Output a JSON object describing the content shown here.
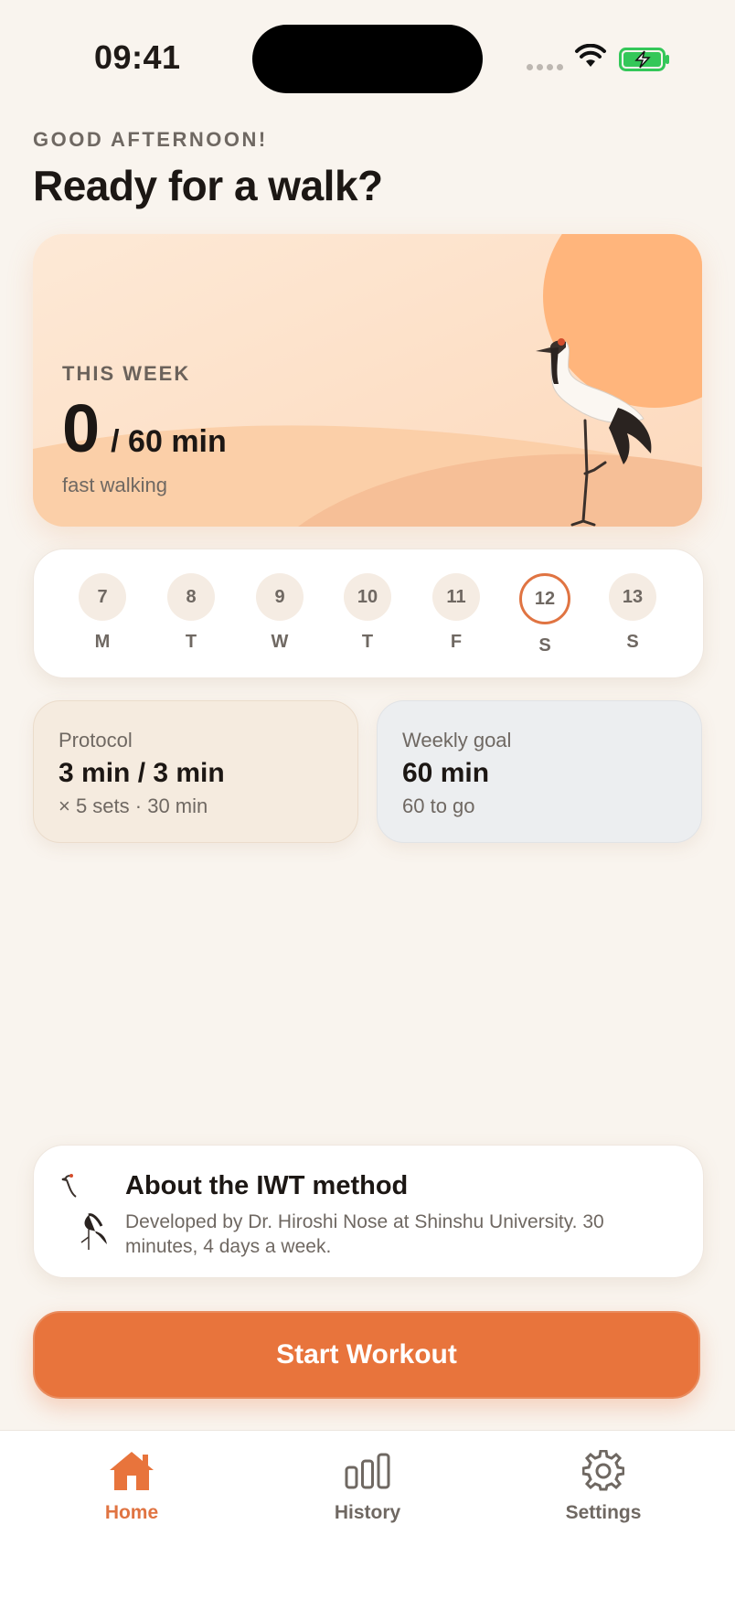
{
  "status_bar": {
    "time": "09:41"
  },
  "header": {
    "greeting": "GOOD AFTERNOON!",
    "title": "Ready for a walk?"
  },
  "hero": {
    "label": "THIS WEEK",
    "value": "0",
    "goal": "/ 60 min",
    "subtitle": "fast walking",
    "progress_fraction": 0
  },
  "week": {
    "days": [
      {
        "num": "7",
        "letter": "M"
      },
      {
        "num": "8",
        "letter": "T"
      },
      {
        "num": "9",
        "letter": "W"
      },
      {
        "num": "10",
        "letter": "T"
      },
      {
        "num": "11",
        "letter": "F"
      },
      {
        "num": "12",
        "letter": "S",
        "today": true
      },
      {
        "num": "13",
        "letter": "S"
      }
    ]
  },
  "protocol": {
    "label": "Protocol",
    "value": "3 min / 3 min",
    "sub": "× 5 sets · 30 min"
  },
  "weekly_goal": {
    "label": "Weekly goal",
    "value": "60 min",
    "sub": "60 to go"
  },
  "about": {
    "title": "About the IWT method",
    "description": "Developed by Dr. Hiroshi Nose at Shinshu University. 30 minutes, 4 days a week.",
    "icon": "crane-icon"
  },
  "start_button": {
    "label": "Start Workout"
  },
  "tabbar": {
    "home": {
      "label": "Home",
      "icon": "home-icon"
    },
    "history": {
      "label": "History",
      "icon": "bar-chart-icon"
    },
    "settings": {
      "label": "Settings",
      "icon": "gear-icon"
    }
  },
  "colors": {
    "accent": "#e8743c",
    "background": "#f9f4ee",
    "hero_sun": "#ffb57c"
  }
}
